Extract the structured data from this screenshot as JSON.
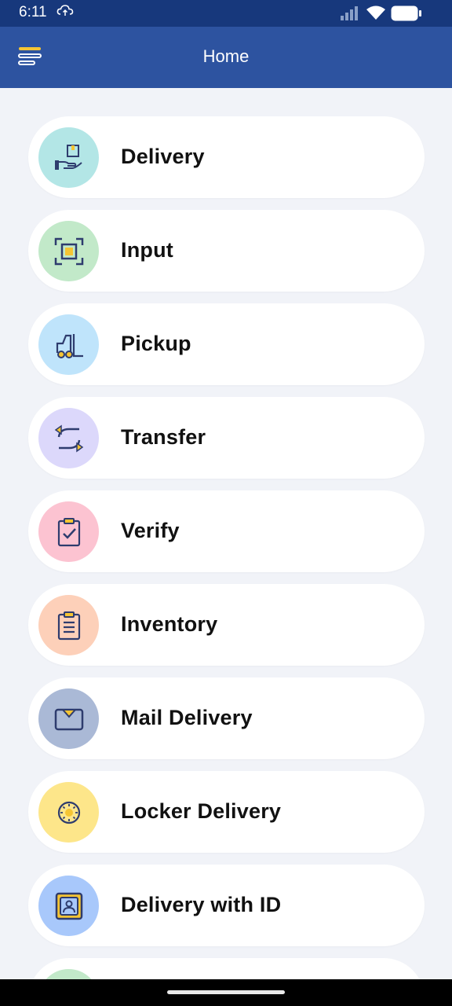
{
  "status": {
    "time": "6:11"
  },
  "header": {
    "title": "Home"
  },
  "colors": {
    "status_bar": "#17387c",
    "app_bar": "#2d53a0",
    "background": "#f1f3f8",
    "accent": "#f5c534",
    "icon_stroke": "#2e3c6e"
  },
  "menu": [
    {
      "label": "Delivery",
      "icon": "hand-box-icon",
      "color": "#b3e6e6"
    },
    {
      "label": "Input",
      "icon": "scan-frame-icon",
      "color": "#c2e9c9"
    },
    {
      "label": "Pickup",
      "icon": "forklift-icon",
      "color": "#bfe4fb"
    },
    {
      "label": "Transfer",
      "icon": "transfer-arrows-icon",
      "color": "#dcd8fb"
    },
    {
      "label": "Verify",
      "icon": "clipboard-check-icon",
      "color": "#fcc3d1"
    },
    {
      "label": "Inventory",
      "icon": "clipboard-list-icon",
      "color": "#fdd0b9"
    },
    {
      "label": "Mail Delivery",
      "icon": "mail-icon",
      "color": "#aab9d6"
    },
    {
      "label": "Locker Delivery",
      "icon": "locker-dial-icon",
      "color": "#fde68a"
    },
    {
      "label": "Delivery with ID",
      "icon": "id-card-icon",
      "color": "#a8c8fb"
    },
    {
      "label": "",
      "icon": "partial-item-icon",
      "color": "#c2e9c9"
    }
  ]
}
